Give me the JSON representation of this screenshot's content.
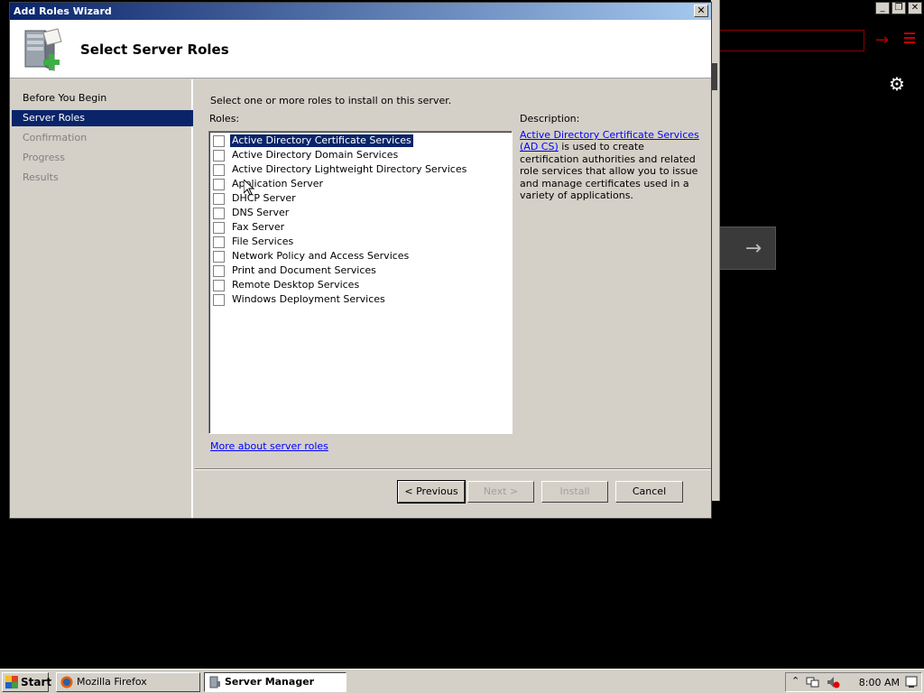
{
  "dialog": {
    "title": "Add Roles Wizard",
    "close_label": "✕",
    "header_title": "Select Server Roles"
  },
  "sidebar": {
    "items": [
      {
        "label": "Before You Begin",
        "state": "normal"
      },
      {
        "label": "Server Roles",
        "state": "active"
      },
      {
        "label": "Confirmation",
        "state": "disabled"
      },
      {
        "label": "Progress",
        "state": "disabled"
      },
      {
        "label": "Results",
        "state": "disabled"
      }
    ]
  },
  "main": {
    "instruction": "Select one or more roles to install on this server.",
    "roles_label": "Roles:",
    "roles": [
      {
        "label": "Active Directory Certificate Services",
        "checked": false,
        "selected": true
      },
      {
        "label": "Active Directory Domain Services",
        "checked": false,
        "selected": false
      },
      {
        "label": "Active Directory Lightweight Directory Services",
        "checked": false,
        "selected": false
      },
      {
        "label": "Application Server",
        "checked": false,
        "selected": false
      },
      {
        "label": "DHCP Server",
        "checked": false,
        "selected": false
      },
      {
        "label": "DNS Server",
        "checked": false,
        "selected": false
      },
      {
        "label": "Fax Server",
        "checked": false,
        "selected": false
      },
      {
        "label": "File Services",
        "checked": false,
        "selected": false
      },
      {
        "label": "Network Policy and Access Services",
        "checked": false,
        "selected": false
      },
      {
        "label": "Print and Document Services",
        "checked": false,
        "selected": false
      },
      {
        "label": "Remote Desktop Services",
        "checked": false,
        "selected": false
      },
      {
        "label": "Windows Deployment Services",
        "checked": false,
        "selected": false
      }
    ],
    "description_label": "Description:",
    "description_link": "Active Directory Certificate Services (AD CS)",
    "description_text": " is used to create certification authorities and related role services that allow you to issue and manage certificates used in a variety of applications.",
    "more_link": "More about server roles"
  },
  "buttons": {
    "previous": "< Previous",
    "next": "Next >",
    "install": "Install",
    "cancel": "Cancel"
  },
  "taskbar": {
    "start": "Start",
    "tasks": [
      {
        "label": "Mozilla Firefox",
        "active": false
      },
      {
        "label": "Server Manager",
        "active": true
      }
    ],
    "clock": "8:00 AM"
  },
  "background": {
    "controls": [
      "_",
      "❐",
      "✕"
    ],
    "gear_glyph": "⚙",
    "red_arrow": "→",
    "panel_arrow": "→"
  },
  "colors": {
    "selection": "#0a246a",
    "link": "#0000ff",
    "dialog_face": "#d4d0c8"
  }
}
